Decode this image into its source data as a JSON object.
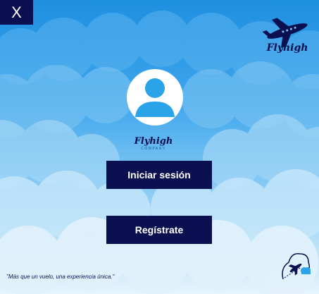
{
  "window": {
    "close_label": "X"
  },
  "corner_brand": {
    "name": "Flyhigh",
    "icon": "airplane-icon"
  },
  "avatar": {
    "icon": "user-icon"
  },
  "brand": {
    "name": "Flyhigh",
    "subtitle": "COMPANY"
  },
  "actions": {
    "login_label": "Iniciar sesión",
    "register_label": "Regístrate"
  },
  "tagline": "\"Más que un vuelo, una experiencia única.\"",
  "badge": {
    "icon": "plane-cloud-icon"
  },
  "colors": {
    "navy": "#0a1050",
    "sky_top": "#1f8fe0",
    "sky_bottom": "#e6f4fc"
  }
}
